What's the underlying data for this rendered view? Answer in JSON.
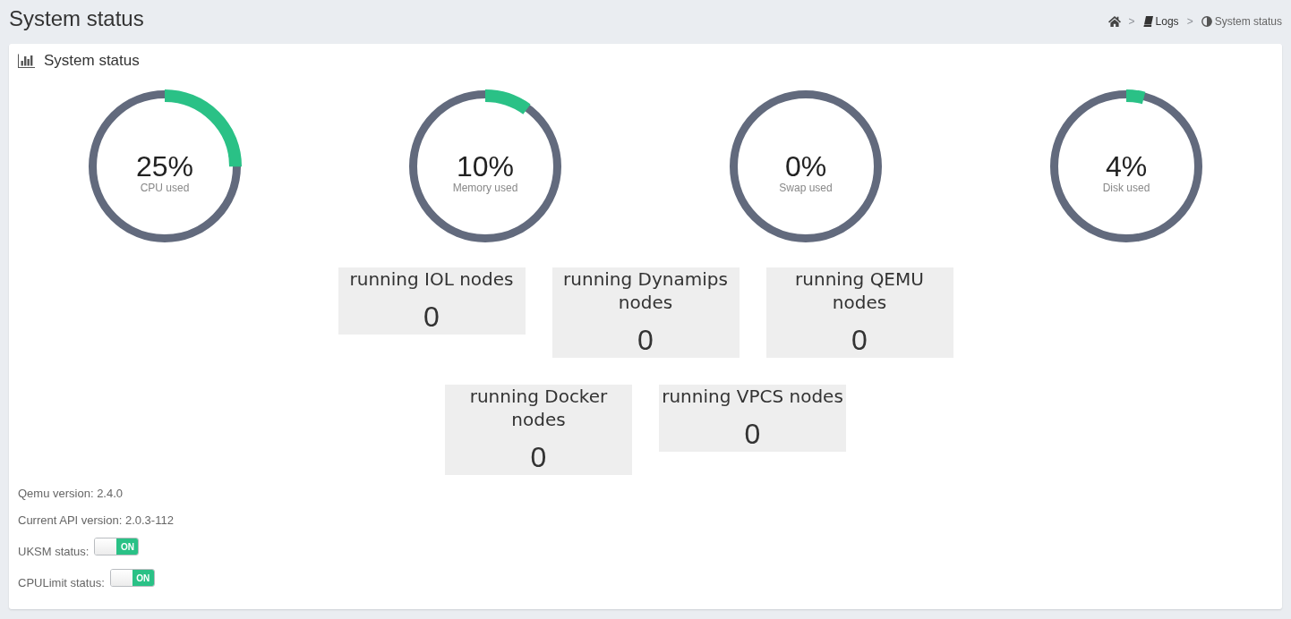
{
  "header": {
    "title": "System status"
  },
  "breadcrumb": [
    {
      "kind": "home"
    },
    {
      "kind": "separator",
      "text": ">"
    },
    {
      "kind": "link",
      "label": "Logs"
    },
    {
      "kind": "separator",
      "text": ">"
    },
    {
      "kind": "current",
      "label": "System status"
    }
  ],
  "panel": {
    "title": "System status",
    "gauges": [
      {
        "value": "25%",
        "label": "CPU used",
        "level": 0.25
      },
      {
        "value": "10%",
        "label": "Memory used",
        "level": 0.1
      },
      {
        "value": "0%",
        "label": "Swap used",
        "level": 0
      },
      {
        "value": "4%",
        "label": "Disk used",
        "level": 0.04
      }
    ],
    "node_rows": [
      {
        "cards": [
          {
            "title": "running IOL nodes",
            "count": "0"
          },
          {
            "title": "running Dynamips nodes",
            "count": "0"
          },
          {
            "title": "running QEMU nodes",
            "count": "0"
          }
        ]
      },
      {
        "cards": [
          {
            "title": "running Docker nodes",
            "count": "0"
          },
          {
            "title": "running VPCS nodes",
            "count": "0"
          }
        ]
      }
    ],
    "info": [
      {
        "kind": "text",
        "text": "Qemu version: 2.4.0"
      },
      {
        "kind": "text",
        "text": "Current API version: 2.0.3-112"
      },
      {
        "kind": "toggle",
        "label": "UKSM status:",
        "on": true,
        "switch_text": "ON"
      },
      {
        "kind": "toggle",
        "label": "CPULimit status:",
        "on": true,
        "switch_text": "ON"
      }
    ]
  }
}
